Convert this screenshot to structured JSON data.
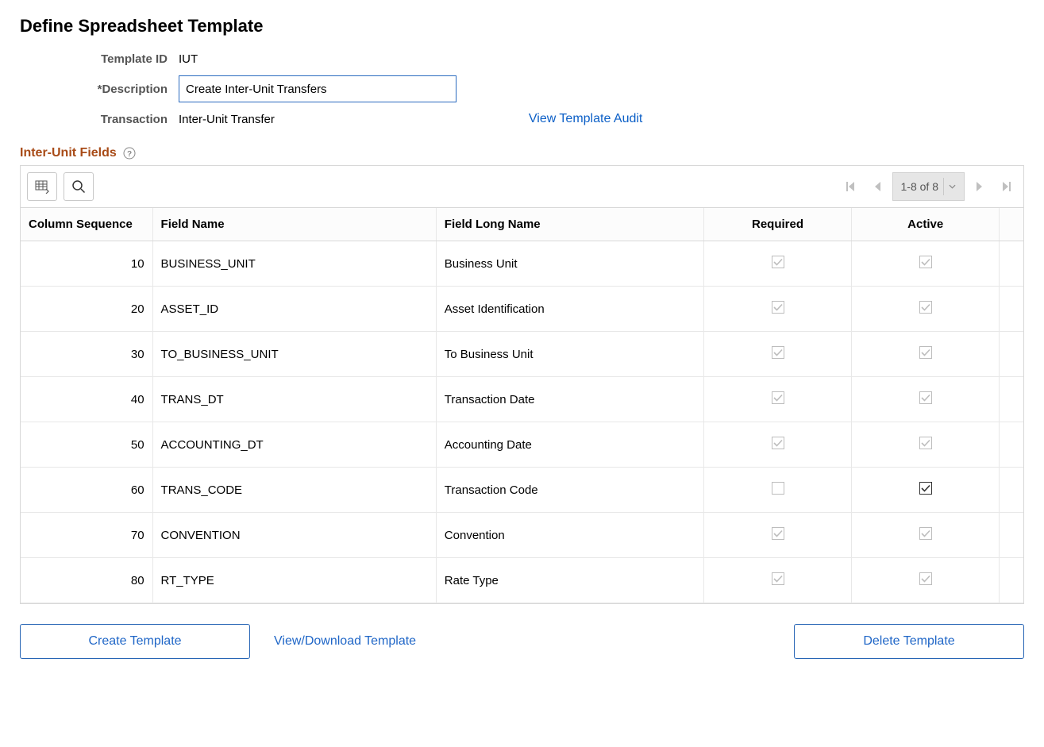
{
  "page_title": "Define Spreadsheet Template",
  "header": {
    "template_id_label": "Template ID",
    "template_id_value": "IUT",
    "description_label": "*Description",
    "description_value": "Create Inter-Unit Transfers",
    "transaction_label": "Transaction",
    "transaction_value": "Inter-Unit Transfer",
    "audit_link": "View Template Audit"
  },
  "section": {
    "title": "Inter-Unit Fields"
  },
  "pager": {
    "range": "1-8 of 8"
  },
  "columns": {
    "seq": "Column Sequence",
    "fname": "Field Name",
    "flname": "Field Long Name",
    "required": "Required",
    "active": "Active"
  },
  "rows": [
    {
      "seq": "10",
      "fname": "BUSINESS_UNIT",
      "flname": "Business Unit",
      "required": true,
      "req_enabled": false,
      "active": true,
      "act_enabled": false
    },
    {
      "seq": "20",
      "fname": "ASSET_ID",
      "flname": "Asset Identification",
      "required": true,
      "req_enabled": false,
      "active": true,
      "act_enabled": false
    },
    {
      "seq": "30",
      "fname": "TO_BUSINESS_UNIT",
      "flname": "To Business Unit",
      "required": true,
      "req_enabled": false,
      "active": true,
      "act_enabled": false
    },
    {
      "seq": "40",
      "fname": "TRANS_DT",
      "flname": "Transaction Date",
      "required": true,
      "req_enabled": false,
      "active": true,
      "act_enabled": false
    },
    {
      "seq": "50",
      "fname": "ACCOUNTING_DT",
      "flname": "Accounting Date",
      "required": true,
      "req_enabled": false,
      "active": true,
      "act_enabled": false
    },
    {
      "seq": "60",
      "fname": "TRANS_CODE",
      "flname": "Transaction Code",
      "required": false,
      "req_enabled": false,
      "active": true,
      "act_enabled": true
    },
    {
      "seq": "70",
      "fname": "CONVENTION",
      "flname": "Convention",
      "required": true,
      "req_enabled": false,
      "active": true,
      "act_enabled": false
    },
    {
      "seq": "80",
      "fname": "RT_TYPE",
      "flname": "Rate Type",
      "required": true,
      "req_enabled": false,
      "active": true,
      "act_enabled": false
    }
  ],
  "buttons": {
    "create": "Create Template",
    "view_download": "View/Download Template",
    "delete": "Delete Template"
  }
}
